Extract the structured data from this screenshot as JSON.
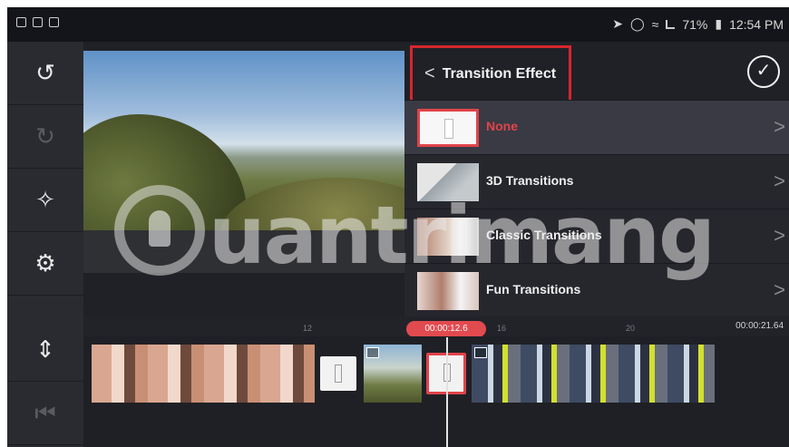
{
  "status_bar": {
    "left_icons": [
      "music-note-icon",
      "gallery-icon",
      "settings-icon"
    ],
    "right_icons": [
      "location-icon",
      "alarm-icon",
      "wifi-icon",
      "signal-icon"
    ],
    "battery": "71%",
    "time": "12:54 PM"
  },
  "toolbar": {
    "items": [
      {
        "icon": "undo-icon",
        "enabled": true
      },
      {
        "icon": "redo-icon",
        "enabled": false
      },
      {
        "icon": "share-icon",
        "enabled": true
      },
      {
        "icon": "settings-icon",
        "enabled": true
      },
      {
        "icon": "split-icon",
        "enabled": true
      },
      {
        "icon": "jump-to-start-icon",
        "enabled": false
      }
    ]
  },
  "panel": {
    "back_label": "Transition Effect",
    "confirm_icon": "check-circle-icon",
    "items": [
      {
        "label": "None",
        "selected": true
      },
      {
        "label": "3D Transitions",
        "selected": false
      },
      {
        "label": "Classic Transitions",
        "selected": false
      },
      {
        "label": "Fun Transitions",
        "selected": false
      }
    ]
  },
  "timeline": {
    "current_time": "00:00:12.6",
    "total_time": "00:00:21.64",
    "ticks": [
      "12",
      "16",
      "20"
    ]
  },
  "watermark": "uantrimang",
  "colors": {
    "accent": "#e0434a",
    "background": "#202127",
    "panel": "#26272d"
  }
}
